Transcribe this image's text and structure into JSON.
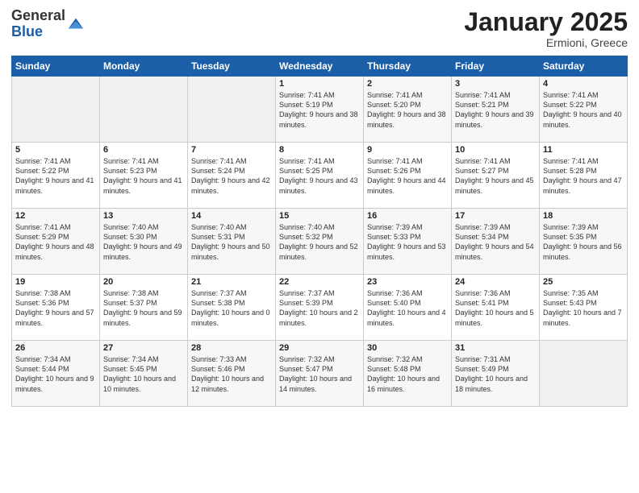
{
  "header": {
    "logo_general": "General",
    "logo_blue": "Blue",
    "title": "January 2025",
    "subtitle": "Ermioni, Greece"
  },
  "days_of_week": [
    "Sunday",
    "Monday",
    "Tuesday",
    "Wednesday",
    "Thursday",
    "Friday",
    "Saturday"
  ],
  "weeks": [
    [
      {
        "day": "",
        "info": ""
      },
      {
        "day": "",
        "info": ""
      },
      {
        "day": "",
        "info": ""
      },
      {
        "day": "1",
        "info": "Sunrise: 7:41 AM\nSunset: 5:19 PM\nDaylight: 9 hours and 38 minutes."
      },
      {
        "day": "2",
        "info": "Sunrise: 7:41 AM\nSunset: 5:20 PM\nDaylight: 9 hours and 38 minutes."
      },
      {
        "day": "3",
        "info": "Sunrise: 7:41 AM\nSunset: 5:21 PM\nDaylight: 9 hours and 39 minutes."
      },
      {
        "day": "4",
        "info": "Sunrise: 7:41 AM\nSunset: 5:22 PM\nDaylight: 9 hours and 40 minutes."
      }
    ],
    [
      {
        "day": "5",
        "info": "Sunrise: 7:41 AM\nSunset: 5:22 PM\nDaylight: 9 hours and 41 minutes."
      },
      {
        "day": "6",
        "info": "Sunrise: 7:41 AM\nSunset: 5:23 PM\nDaylight: 9 hours and 41 minutes."
      },
      {
        "day": "7",
        "info": "Sunrise: 7:41 AM\nSunset: 5:24 PM\nDaylight: 9 hours and 42 minutes."
      },
      {
        "day": "8",
        "info": "Sunrise: 7:41 AM\nSunset: 5:25 PM\nDaylight: 9 hours and 43 minutes."
      },
      {
        "day": "9",
        "info": "Sunrise: 7:41 AM\nSunset: 5:26 PM\nDaylight: 9 hours and 44 minutes."
      },
      {
        "day": "10",
        "info": "Sunrise: 7:41 AM\nSunset: 5:27 PM\nDaylight: 9 hours and 45 minutes."
      },
      {
        "day": "11",
        "info": "Sunrise: 7:41 AM\nSunset: 5:28 PM\nDaylight: 9 hours and 47 minutes."
      }
    ],
    [
      {
        "day": "12",
        "info": "Sunrise: 7:41 AM\nSunset: 5:29 PM\nDaylight: 9 hours and 48 minutes."
      },
      {
        "day": "13",
        "info": "Sunrise: 7:40 AM\nSunset: 5:30 PM\nDaylight: 9 hours and 49 minutes."
      },
      {
        "day": "14",
        "info": "Sunrise: 7:40 AM\nSunset: 5:31 PM\nDaylight: 9 hours and 50 minutes."
      },
      {
        "day": "15",
        "info": "Sunrise: 7:40 AM\nSunset: 5:32 PM\nDaylight: 9 hours and 52 minutes."
      },
      {
        "day": "16",
        "info": "Sunrise: 7:39 AM\nSunset: 5:33 PM\nDaylight: 9 hours and 53 minutes."
      },
      {
        "day": "17",
        "info": "Sunrise: 7:39 AM\nSunset: 5:34 PM\nDaylight: 9 hours and 54 minutes."
      },
      {
        "day": "18",
        "info": "Sunrise: 7:39 AM\nSunset: 5:35 PM\nDaylight: 9 hours and 56 minutes."
      }
    ],
    [
      {
        "day": "19",
        "info": "Sunrise: 7:38 AM\nSunset: 5:36 PM\nDaylight: 9 hours and 57 minutes."
      },
      {
        "day": "20",
        "info": "Sunrise: 7:38 AM\nSunset: 5:37 PM\nDaylight: 9 hours and 59 minutes."
      },
      {
        "day": "21",
        "info": "Sunrise: 7:37 AM\nSunset: 5:38 PM\nDaylight: 10 hours and 0 minutes."
      },
      {
        "day": "22",
        "info": "Sunrise: 7:37 AM\nSunset: 5:39 PM\nDaylight: 10 hours and 2 minutes."
      },
      {
        "day": "23",
        "info": "Sunrise: 7:36 AM\nSunset: 5:40 PM\nDaylight: 10 hours and 4 minutes."
      },
      {
        "day": "24",
        "info": "Sunrise: 7:36 AM\nSunset: 5:41 PM\nDaylight: 10 hours and 5 minutes."
      },
      {
        "day": "25",
        "info": "Sunrise: 7:35 AM\nSunset: 5:43 PM\nDaylight: 10 hours and 7 minutes."
      }
    ],
    [
      {
        "day": "26",
        "info": "Sunrise: 7:34 AM\nSunset: 5:44 PM\nDaylight: 10 hours and 9 minutes."
      },
      {
        "day": "27",
        "info": "Sunrise: 7:34 AM\nSunset: 5:45 PM\nDaylight: 10 hours and 10 minutes."
      },
      {
        "day": "28",
        "info": "Sunrise: 7:33 AM\nSunset: 5:46 PM\nDaylight: 10 hours and 12 minutes."
      },
      {
        "day": "29",
        "info": "Sunrise: 7:32 AM\nSunset: 5:47 PM\nDaylight: 10 hours and 14 minutes."
      },
      {
        "day": "30",
        "info": "Sunrise: 7:32 AM\nSunset: 5:48 PM\nDaylight: 10 hours and 16 minutes."
      },
      {
        "day": "31",
        "info": "Sunrise: 7:31 AM\nSunset: 5:49 PM\nDaylight: 10 hours and 18 minutes."
      },
      {
        "day": "",
        "info": ""
      }
    ]
  ]
}
